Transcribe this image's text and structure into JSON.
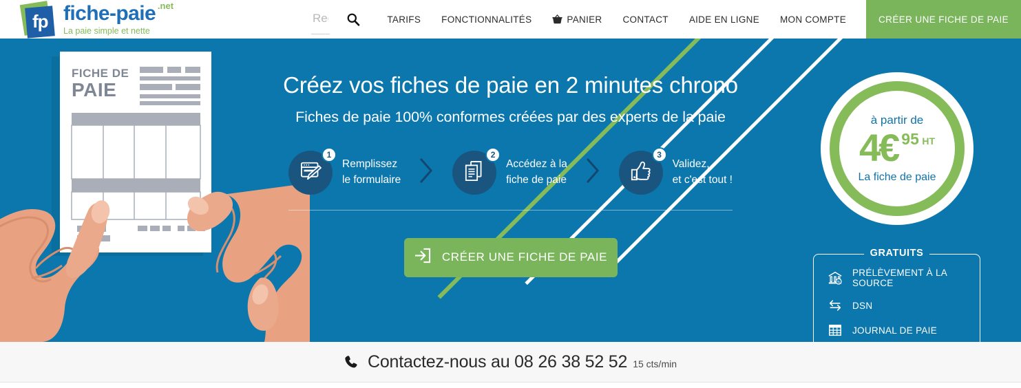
{
  "colors": {
    "hero_blue": "#0b77ad",
    "green": "#7ab55c",
    "badge_green": "#86bb5a",
    "logo_blue": "#1f6fb8",
    "step_navy": "#1a5580",
    "contact_bg": "#f7f7f7"
  },
  "header": {
    "logo": {
      "mark_text": "fp",
      "name": "fiche-paie",
      "dotnet": ".net",
      "tagline": "La paie simple et nette"
    },
    "search": {
      "placeholder": "Rechercher..",
      "value": "",
      "icon": "search-icon"
    },
    "nav_items": [
      {
        "label": "TARIFS",
        "icon": null
      },
      {
        "label": "FONCTIONNALITÉS",
        "icon": null
      },
      {
        "label": "PANIER",
        "icon": "cart-icon"
      },
      {
        "label": "CONTACT",
        "icon": null
      },
      {
        "label": "AIDE EN LIGNE",
        "icon": null
      },
      {
        "label": "MON COMPTE",
        "icon": null
      }
    ],
    "cta_label": "CRÉER UNE FICHE DE PAIE"
  },
  "hero": {
    "heading": "Créez vos fiches de paie en 2 minutes chrono",
    "subheading": "Fiches de paie 100% conformes créées par des experts de la paie",
    "steps": [
      {
        "number": "1",
        "icon": "form-window-icon",
        "line1": "Remplissez",
        "line2": "le formulaire"
      },
      {
        "number": "2",
        "icon": "documents-icon",
        "line1": "Accédez à la",
        "line2": "fiche de paie"
      },
      {
        "number": "3",
        "icon": "thumbs-up-icon",
        "line1": "Validez,",
        "line2": "et c'est tout !"
      }
    ],
    "cta": {
      "label": "CRÉER UNE FICHE DE PAIE",
      "icon": "login-arrow-icon"
    },
    "illustration": {
      "doc_title_line1": "FICHE DE",
      "doc_title_line2": "PAIE"
    }
  },
  "price_badge": {
    "top_label": "à partir de",
    "amount": "4€",
    "cents": "95",
    "tax_note": "HT",
    "bottom_label": "La fiche de paie"
  },
  "gratuits": {
    "title": "GRATUITS",
    "items": [
      {
        "label": "PRÉLÈVEMENT À LA SOURCE",
        "icon": "bank-icon"
      },
      {
        "label": "DSN",
        "icon": "exchange-arrows-icon"
      },
      {
        "label": "JOURNAL DE PAIE",
        "icon": "table-grid-icon"
      }
    ]
  },
  "contact_bar": {
    "icon": "phone-icon",
    "text": "Contactez-nous au 08 26 38 52 52",
    "rate": "15 cts/min"
  }
}
